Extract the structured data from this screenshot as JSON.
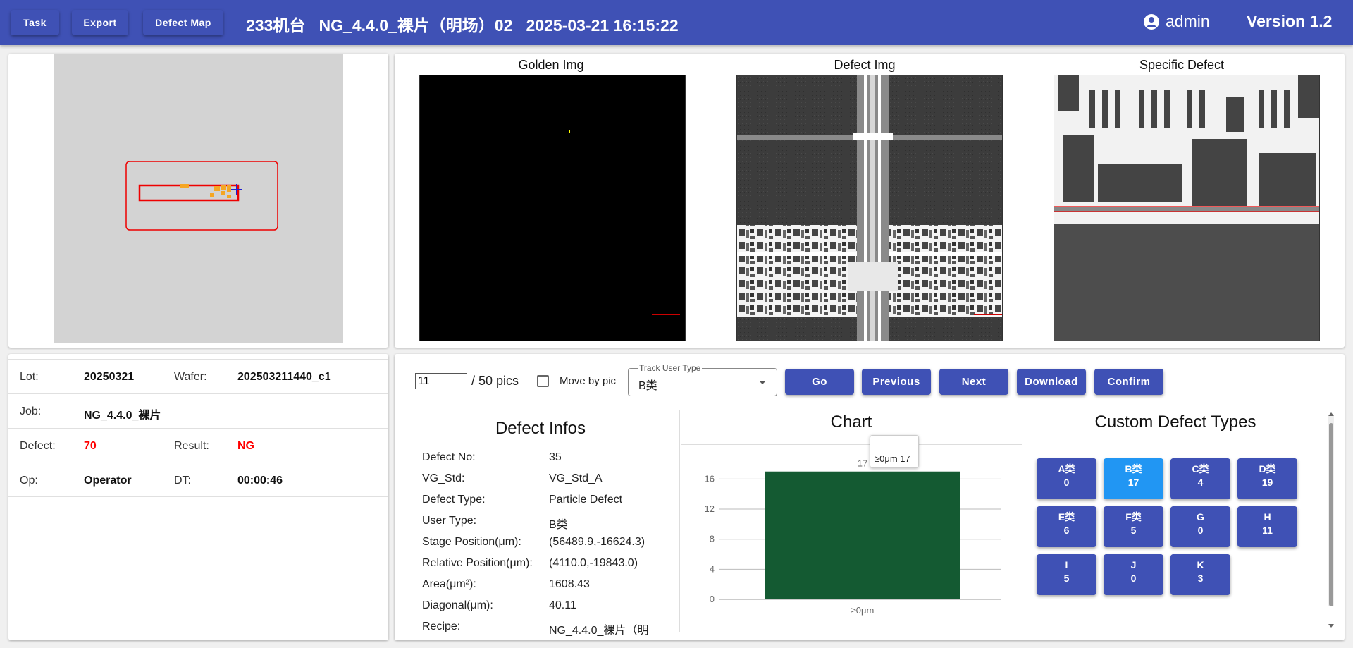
{
  "header": {
    "buttons": {
      "task": "Task",
      "export": "Export",
      "defect_map": "Defect Map"
    },
    "title": "233机台   NG_4.4.0_裸片（明场）02   2025-03-21 16:15:22",
    "user": "admin",
    "version": "Version 1.2",
    "color": "#3f51b5"
  },
  "images": {
    "golden": "Golden Img",
    "defect": "Defect Img",
    "specific": "Specific Defect"
  },
  "info": {
    "lot_label": "Lot:",
    "lot": "20250321",
    "wafer_label": "Wafer:",
    "wafer": "202503211440_c1",
    "job_label": "Job:",
    "job": "NG_4.4.0_裸片",
    "defect_label": "Defect:",
    "defect": "70",
    "result_label": "Result:",
    "result": "NG",
    "op_label": "Op:",
    "op": "Operator",
    "dt_label": "DT:",
    "dt": "00:00:46"
  },
  "controls": {
    "pic_index": "11",
    "pic_total": "/ 50 pics",
    "move_by_pic": "Move by pic",
    "track_user_type_label": "Track User Type",
    "track_user_type_value": "B类",
    "go": "Go",
    "previous": "Previous",
    "next": "Next",
    "download": "Download",
    "confirm": "Confirm"
  },
  "defect_infos": {
    "title": "Defect Infos",
    "rows": [
      {
        "label": "Defect No:",
        "value": "35"
      },
      {
        "label": "VG_Std:",
        "value": "VG_Std_A"
      },
      {
        "label": "Defect Type:",
        "value": "Particle Defect"
      },
      {
        "label": "User Type:",
        "value": "B类"
      },
      {
        "label": "Stage Position(μm):",
        "value": "(56489.9,-16624.3)"
      },
      {
        "label": "Relative Position(μm):",
        "value": "(4110.0,-19843.0)"
      },
      {
        "label": "Area(μm²):",
        "value": "1608.43"
      },
      {
        "label": "Diagonal(μm):",
        "value": "40.11"
      },
      {
        "label": "Recipe:",
        "value": "NG_4.4.0_裸片（明"
      }
    ]
  },
  "chart": {
    "title": "Chart",
    "tooltip": "≥0μm 17",
    "bar_label": "17",
    "bar_color": "#145a32"
  },
  "chart_data": {
    "type": "bar",
    "categories": [
      "≥0μm"
    ],
    "values": [
      17
    ],
    "ylim": [
      0,
      18
    ],
    "yticks": [
      "16",
      "12",
      "8",
      "4",
      "0"
    ],
    "grid": true
  },
  "custom_types": {
    "title": "Custom Defect Types",
    "items": [
      {
        "name": "A类",
        "count": "0"
      },
      {
        "name": "B类",
        "count": "17"
      },
      {
        "name": "C类",
        "count": "4"
      },
      {
        "name": "D类",
        "count": "19"
      },
      {
        "name": "E类",
        "count": "6"
      },
      {
        "name": "F类",
        "count": "5"
      },
      {
        "name": "G",
        "count": "0"
      },
      {
        "name": "H",
        "count": "11"
      },
      {
        "name": "I",
        "count": "5"
      },
      {
        "name": "J",
        "count": "0"
      },
      {
        "name": "K",
        "count": "3"
      }
    ],
    "active_color": "#2196f3"
  }
}
